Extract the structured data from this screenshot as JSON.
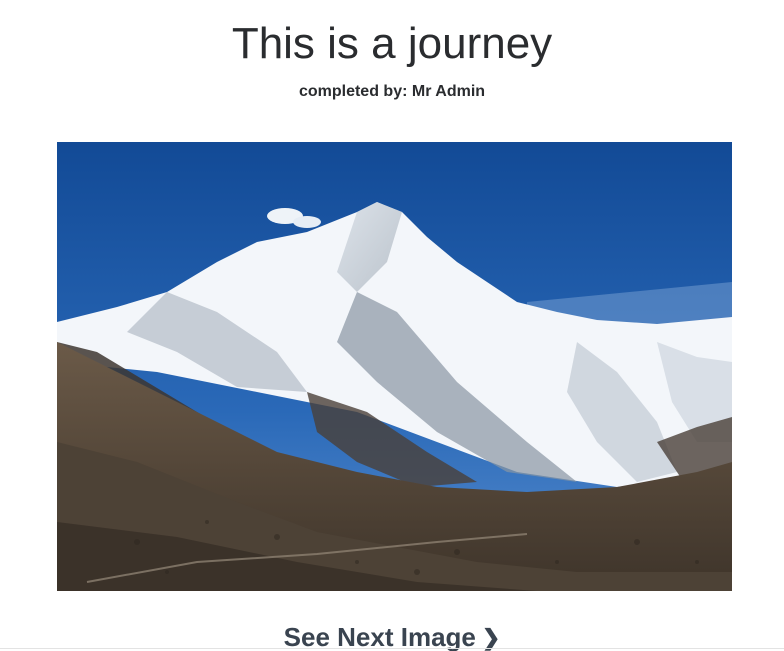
{
  "header": {
    "title": "This is a journey",
    "byline": "completed by: Mr Admin"
  },
  "photo": {
    "subject": "snow-capped mountain peak under blue sky"
  },
  "navigation": {
    "next_label": "See Next Image",
    "next_icon": "chevron-right-icon"
  },
  "colors": {
    "sky": "#1e5aa8",
    "snow": "#f2f5f9",
    "rock": "#5a4a3c",
    "text": "#2a2c2f",
    "link": "#3a4450"
  }
}
